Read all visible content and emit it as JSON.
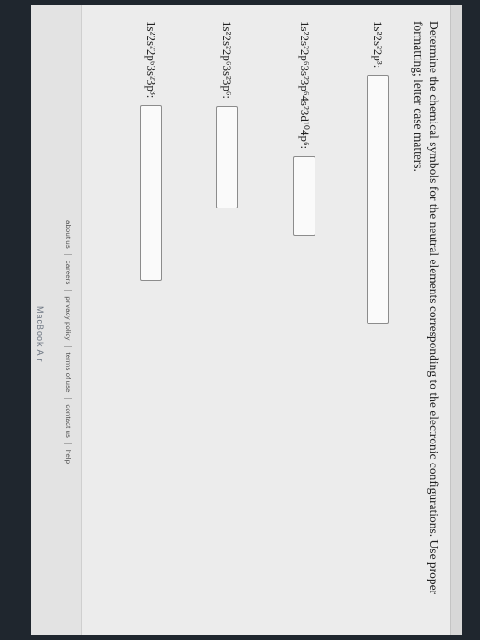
{
  "question": "Determine the chemical symbols for the neutral elements corresponding to the electronic configurations. Use proper formatting; letter case matters.",
  "configs": [
    "1s²2s²2p³:",
    "1s²2s²2p⁶3s²3p⁶4s²3d¹⁰4p⁶:",
    "1s²2s²2p⁶3s²3p⁶:",
    "1s²2s²2p⁶3s²3p³:"
  ],
  "footer": {
    "links": [
      "about us",
      "careers",
      "privacy policy",
      "terms of use",
      "contact us",
      "help"
    ]
  },
  "device_label": "MacBook Air"
}
